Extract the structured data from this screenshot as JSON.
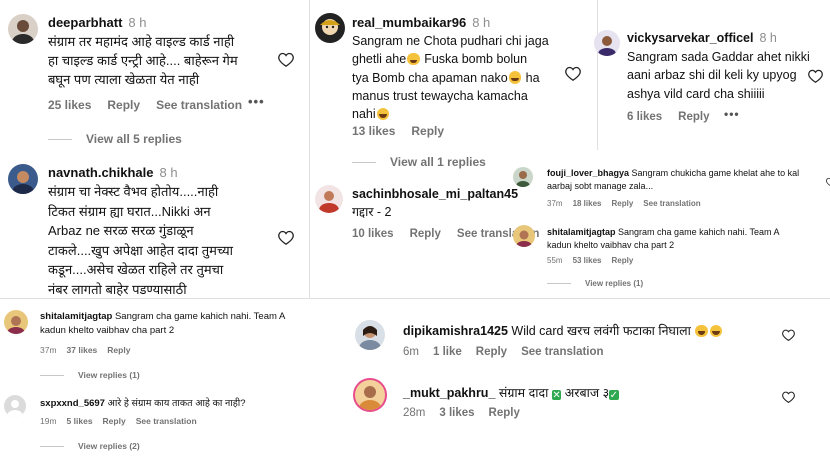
{
  "c1": {
    "user": "deeparbhatt",
    "time": "8 h",
    "lines": [
      "संग्राम तर महामंद आहे वाइल्ड कार्ड नाही",
      "हा चाइल्ड कार्ड एन्ट्री आहे.... बाहेरून गेम",
      "बघून पण त्याला खेळता येत नाही"
    ],
    "likes": "25 likes",
    "reply": "Reply",
    "translate": "See translation",
    "more": "•••"
  },
  "c1_replies": "View all 5 replies",
  "c2": {
    "user": "navnath.chikhale",
    "time": "8 h",
    "lines": [
      "संग्राम चा नेक्स्ट वैभव होतोय.....नाही",
      "टिकत संग्राम ह्या घरात...Nikki अन",
      "Arbaz ne सरळ सरळ गुंडाळून",
      "टाकले....खुप अपेक्षा आहेत दादा तुमच्या",
      "कडून....असेच खेळत राहिले तर तुमचा",
      "नंबर लागतो बाहेर पडण्यासाठी"
    ]
  },
  "c3": {
    "user": "shitalamitjagtap",
    "line1": "Sangram cha game kahich nahi. Team A",
    "line2": "kadun khelto vaibhav cha part 2",
    "time": "37m",
    "likes": "37 likes",
    "reply": "Reply",
    "replies": "View replies (1)"
  },
  "c4": {
    "user": "sxpxxnd_5697",
    "text": "आरे हे संग्राम काय ताकत आहे का नाही?",
    "time": "19m",
    "likes": "5 likes",
    "reply": "Reply",
    "translate": "See translation",
    "replies": "View replies (2)"
  },
  "c5": {
    "user": "real_mumbaikar96",
    "time": "8 h",
    "l1": "Sangram ne Chota pudhari chi jaga",
    "l2": "ghetli ahe",
    "l3a": " Fuska bomb bolun",
    "l4a": "tya Bomb cha apaman nako",
    "l4b": " ha",
    "l5": "manus trust tewaycha kamacha",
    "l6": "nahi",
    "likes": "13 likes",
    "reply": "Reply"
  },
  "c5_replies": "View all 1 replies",
  "c6": {
    "user": "sachinbhosale_mi_paltan45",
    "text": "गद्दार - 2",
    "likes": "10 likes",
    "reply": "Reply",
    "translate": "See translation"
  },
  "c7": {
    "user": "vickysarvekar_officel",
    "time": "8 h",
    "lines": [
      "Sangram sada Gaddar ahet nikki",
      "aani arbaz shi dil keli ky upyog",
      "ashya vild card cha shiiiii"
    ],
    "likes": "6 likes",
    "reply": "Reply",
    "more": "•••"
  },
  "c8": {
    "user": "fouji_lover_bhagya",
    "l1": "Sangram chukicha game khelat ahe to kal",
    "l2": "aarbaj sobt manage zala...",
    "time": "37m",
    "likes": "18 likes",
    "reply": "Reply",
    "translate": "See translation"
  },
  "c9": {
    "user": "shitalamitjagtap",
    "l1": "Sangram cha game kahich nahi. Team A",
    "l2": "kadun khelto vaibhav cha part 2",
    "time": "55m",
    "likes": "53 likes",
    "reply": "Reply",
    "replies": "View replies (1)"
  },
  "c10": {
    "user": "dipikamishra1425",
    "text": "Wild card खरच लवंगी फटाका निघाला",
    "time": "6m",
    "likes": "1 like",
    "reply": "Reply",
    "translate": "See translation"
  },
  "c11": {
    "user": "_mukt_pakhru_",
    "text_a": "संग्राम दादा",
    "text_b": "अरबाज ३",
    "time": "28m",
    "likes": "3 likes",
    "reply": "Reply"
  },
  "colors": {
    "secondary_text": "#737373",
    "emoji": "#f5c23b",
    "check": "#2fa84f"
  },
  "icons": [
    "heart-icon",
    "more-options-icon",
    "avatar"
  ]
}
